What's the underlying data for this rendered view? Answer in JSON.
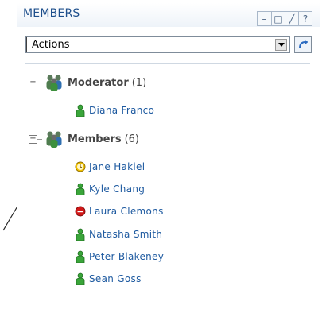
{
  "panel": {
    "title": "MEMBERS",
    "controls": [
      "–",
      "□",
      "╱",
      "?"
    ]
  },
  "actions": {
    "selected": "Actions"
  },
  "groups": [
    {
      "name": "Moderator",
      "count": "(1)",
      "toggle": "−",
      "members": [
        {
          "name": "Diana Franco",
          "status": "online",
          "color": "#3aa53a"
        }
      ]
    },
    {
      "name": "Members",
      "count": "(6)",
      "toggle": "−",
      "members": [
        {
          "name": "Jane Hakiel",
          "status": "away",
          "color": "#e0b000"
        },
        {
          "name": "Kyle Chang",
          "status": "online",
          "color": "#3aa53a"
        },
        {
          "name": "Laura Clemons",
          "status": "busy",
          "color": "#d01818"
        },
        {
          "name": "Natasha Smith",
          "status": "online",
          "color": "#3aa53a"
        },
        {
          "name": "Peter Blakeney",
          "status": "online",
          "color": "#3aa53a"
        },
        {
          "name": "Sean Goss",
          "status": "online",
          "color": "#3aa53a"
        }
      ]
    }
  ],
  "colors": {
    "title": "#1e4f8c",
    "link": "#1e5aa0",
    "border": "#b7c9de"
  }
}
